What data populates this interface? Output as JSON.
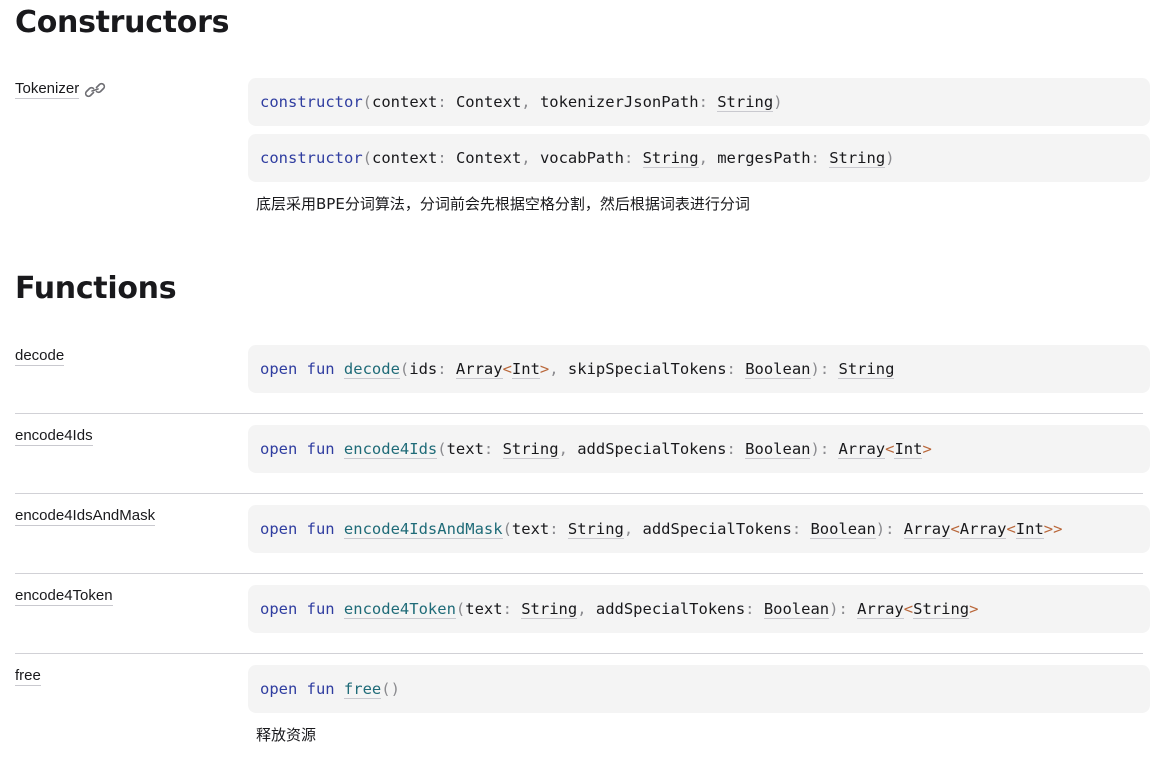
{
  "constructors": {
    "title": "Constructors",
    "name": "Tokenizer",
    "signatures": [
      {
        "name": "constructor",
        "params": [
          {
            "name": "context",
            "type": "Context"
          },
          {
            "name": "tokenizerJsonPath",
            "type": "String"
          }
        ]
      },
      {
        "name": "constructor",
        "params": [
          {
            "name": "context",
            "type": "Context"
          },
          {
            "name": "vocabPath",
            "type": "String"
          },
          {
            "name": "mergesPath",
            "type": "String"
          }
        ]
      }
    ],
    "description": "底层采用BPE分词算法，分词前会先根据空格分割，然后根据词表进行分词"
  },
  "functions": {
    "title": "Functions",
    "items": [
      {
        "name": "decode",
        "keywords": [
          "open",
          "fun"
        ],
        "fn": "decode",
        "params": [
          {
            "name": "ids",
            "type": "Array",
            "generic": "Int"
          },
          {
            "name": "skipSpecialTokens",
            "type": "Boolean"
          }
        ],
        "return": "String"
      },
      {
        "name": "encode4Ids",
        "keywords": [
          "open",
          "fun"
        ],
        "fn": "encode4Ids",
        "params": [
          {
            "name": "text",
            "type": "String"
          },
          {
            "name": "addSpecialTokens",
            "type": "Boolean"
          }
        ],
        "return": "Array<Int>"
      },
      {
        "name": "encode4IdsAndMask",
        "keywords": [
          "open",
          "fun"
        ],
        "fn": "encode4IdsAndMask",
        "params": [
          {
            "name": "text",
            "type": "String"
          },
          {
            "name": "addSpecialTokens",
            "type": "Boolean"
          }
        ],
        "return": "Array<Array<Int>>"
      },
      {
        "name": "encode4Token",
        "keywords": [
          "open",
          "fun"
        ],
        "fn": "encode4Token",
        "params": [
          {
            "name": "text",
            "type": "String"
          },
          {
            "name": "addSpecialTokens",
            "type": "Boolean"
          }
        ],
        "return": "Array<String>"
      },
      {
        "name": "free",
        "keywords": [
          "open",
          "fun"
        ],
        "fn": "free",
        "params": [],
        "return": "",
        "description": "释放资源"
      }
    ]
  }
}
